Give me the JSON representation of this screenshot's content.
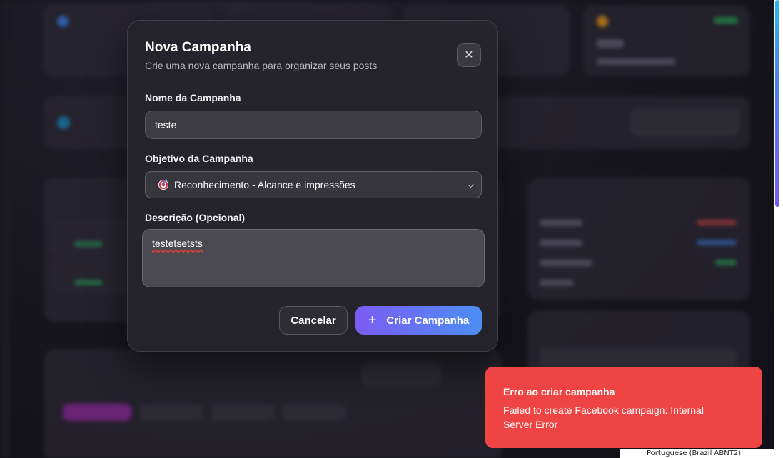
{
  "modal": {
    "title": "Nova Campanha",
    "subtitle": "Crie uma nova campanha para organizar seus posts",
    "close_icon": "close-icon",
    "fields": {
      "name_label": "Nome da Campanha",
      "name_value": "teste",
      "objective_label": "Objetivo da Campanha",
      "objective_value": "Reconhecimento - Alcance e impressões",
      "objective_icon": "target-emoji-icon",
      "description_label": "Descrição (Opcional)",
      "description_value": "testetsetsts"
    },
    "buttons": {
      "cancel": "Cancelar",
      "create": "Criar Campanha",
      "create_icon": "plus-icon"
    }
  },
  "toast": {
    "title": "Erro ao criar campanha",
    "description": "Failed to create Facebook campaign: Internal Server Error",
    "color": "#ef4444"
  },
  "taskbar": {
    "keyboard_layout": "Portuguese (Brazil ABNT2)"
  },
  "colors": {
    "accent_start": "#7b5cf3",
    "accent_end": "#4c8ef4",
    "modal_bg": "#26252c",
    "page_bg": "#141319"
  }
}
